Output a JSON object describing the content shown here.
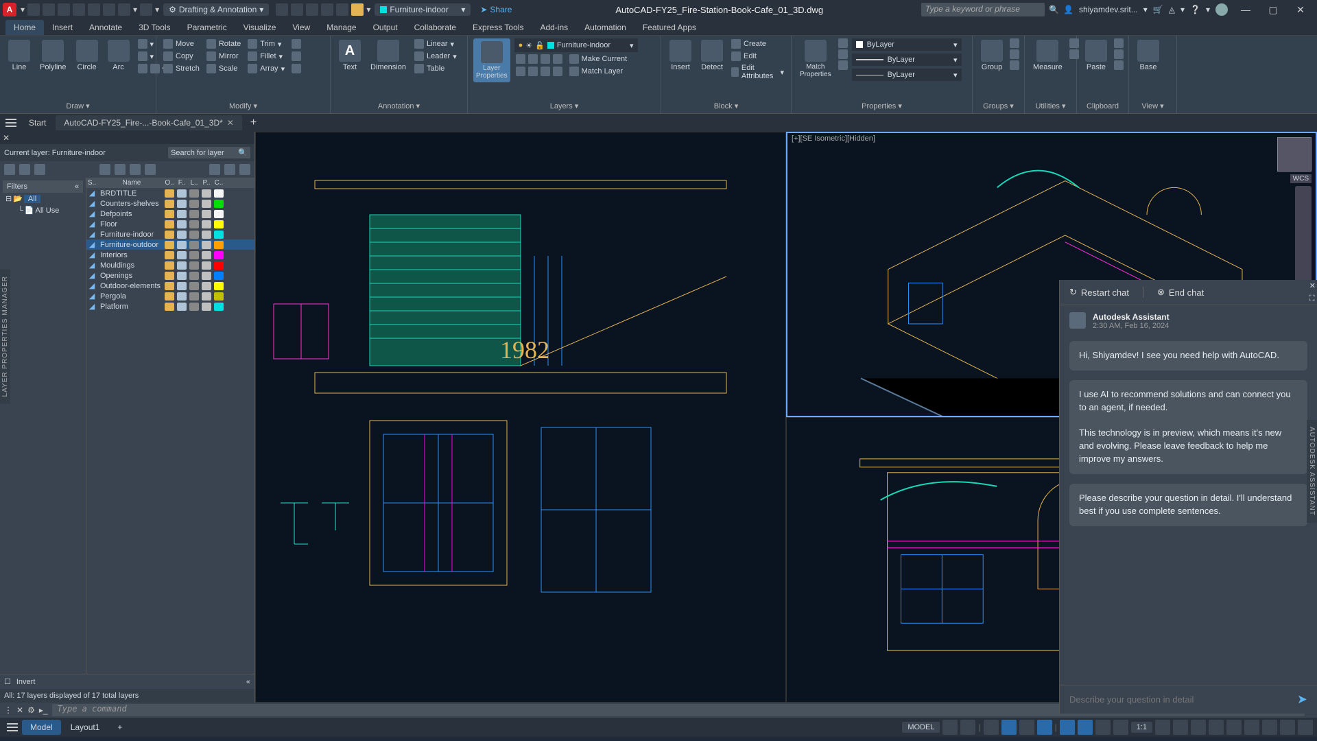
{
  "titlebar": {
    "logo": "A",
    "workspace": "Drafting & Annotation",
    "share": "Share",
    "document": "AutoCAD-FY25_Fire-Station-Book-Cafe_01_3D.dwg",
    "search_placeholder": "Type a keyword or phrase",
    "user": "shiyamdev.srit..."
  },
  "ribbon": {
    "tabs": [
      "Home",
      "Insert",
      "Annotate",
      "3D Tools",
      "Parametric",
      "Visualize",
      "View",
      "Manage",
      "Output",
      "Collaborate",
      "Express Tools",
      "Add-ins",
      "Automation",
      "Featured Apps"
    ],
    "active_tab": "Home",
    "draw": {
      "title": "Draw ▾",
      "line": "Line",
      "polyline": "Polyline",
      "circle": "Circle",
      "arc": "Arc"
    },
    "modify": {
      "title": "Modify ▾",
      "move": "Move",
      "copy": "Copy",
      "stretch": "Stretch",
      "rotate": "Rotate",
      "mirror": "Mirror",
      "scale": "Scale",
      "trim": "Trim",
      "fillet": "Fillet",
      "array": "Array"
    },
    "annotation": {
      "title": "Annotation ▾",
      "text": "Text",
      "dimension": "Dimension",
      "linear": "Linear",
      "leader": "Leader",
      "table": "Table"
    },
    "layers": {
      "title": "Layers ▾",
      "properties": "Layer\nProperties",
      "current": "Furniture-indoor",
      "make_current": "Make Current",
      "match_layer": "Match Layer"
    },
    "block": {
      "title": "Block ▾",
      "insert": "Insert",
      "detect": "Detect",
      "create": "Create",
      "edit": "Edit",
      "edit_attrs": "Edit Attributes"
    },
    "properties": {
      "title": "Properties ▾",
      "match": "Match\nProperties",
      "color": "ByLayer",
      "lw": "ByLayer",
      "lt": "ByLayer"
    },
    "groups": {
      "title": "Groups ▾",
      "group": "Group"
    },
    "utilities": {
      "title": "Utilities ▾",
      "measure": "Measure"
    },
    "clipboard": {
      "title": "Clipboard",
      "paste": "Paste"
    },
    "view": {
      "title": "View ▾",
      "base": "Base"
    }
  },
  "file_tabs": {
    "start": "Start",
    "doc": "AutoCAD-FY25_Fire-...-Book-Cafe_01_3D*"
  },
  "layer_palette": {
    "side_label": "LAYER PROPERTIES MANAGER",
    "current": "Current layer: Furniture-indoor",
    "search_placeholder": "Search for layer",
    "filters_header": "Filters",
    "tree_all": "All",
    "tree_all_used": "All Use",
    "cols": [
      "S..",
      "Name",
      "O..",
      "F..",
      "L..",
      "P..",
      "C.."
    ],
    "layers": [
      {
        "name": "BRDTITLE",
        "color": "#f5f5f5"
      },
      {
        "name": "Counters-shelves",
        "color": "#00e000"
      },
      {
        "name": "Defpoints",
        "color": "#f5f5f5"
      },
      {
        "name": "Floor",
        "color": "#ffff00"
      },
      {
        "name": "Furniture-indoor",
        "color": "#00e0e0"
      },
      {
        "name": "Furniture-outdoor",
        "color": "#ffa000",
        "sel": true
      },
      {
        "name": "Interiors",
        "color": "#ff00ff"
      },
      {
        "name": "Mouldings",
        "color": "#ff0000"
      },
      {
        "name": "Openings",
        "color": "#0080ff"
      },
      {
        "name": "Outdoor-elements",
        "color": "#ffff00"
      },
      {
        "name": "Pergola",
        "color": "#c0c000"
      },
      {
        "name": "Platform",
        "color": "#00e0e0"
      }
    ],
    "invert": "Invert",
    "status": "All: 17 layers displayed of 17 total layers"
  },
  "viewports": {
    "vp1_label": "[+][SE Isometric][Hidden]",
    "wcs": "WCS",
    "year": "1982"
  },
  "assistant": {
    "side_label": "AUTODESK ASSISTANT",
    "restart": "Restart chat",
    "end": "End chat",
    "name": "Autodesk Assistant",
    "time": "2:30 AM, Feb 16, 2024",
    "msg1": "Hi, Shiyamdev! I see you need help with AutoCAD.",
    "msg2": "I use AI to recommend solutions and can connect you to an agent, if needed.\n\nThis technology is in preview, which means it's new and evolving. Please leave feedback to help me improve my answers.",
    "msg3": "Please describe your question in detail. I'll understand best if you use complete sentences.",
    "input_placeholder": "Describe your question in detail"
  },
  "cmdline": {
    "placeholder": "Type a command"
  },
  "statusbar": {
    "model": "Model",
    "layout1": "Layout1",
    "model_label": "MODEL",
    "scale": "1:1"
  }
}
